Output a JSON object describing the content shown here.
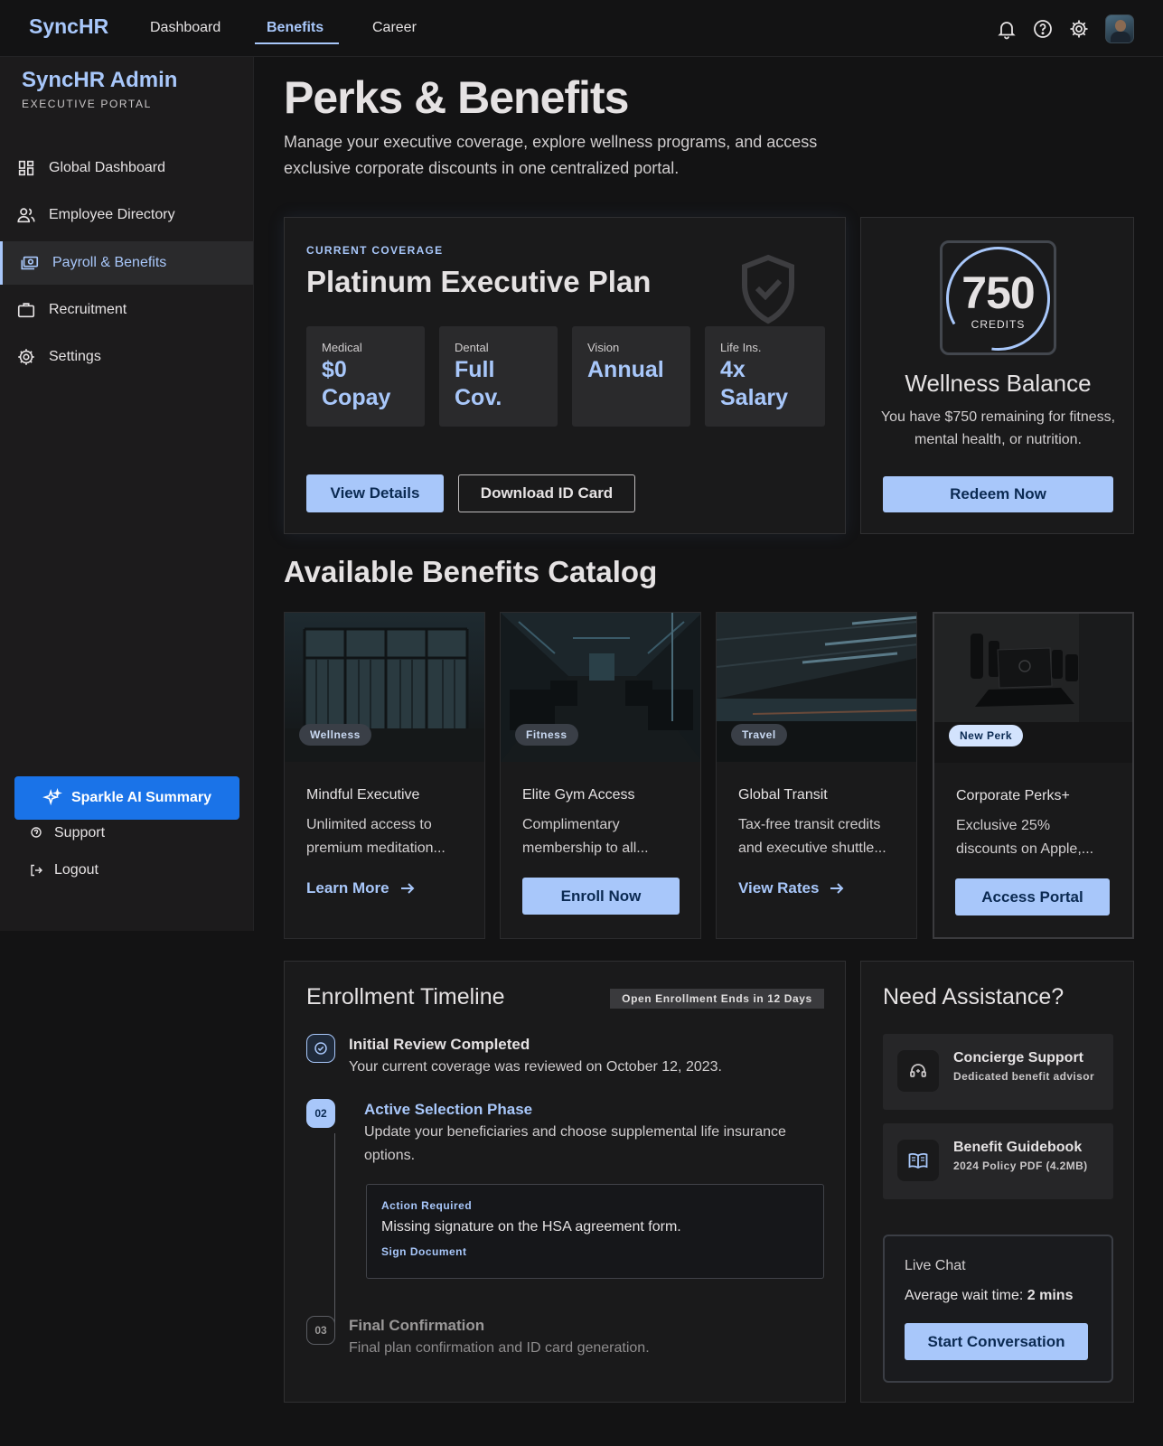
{
  "brand": "SyncHR",
  "top_nav": [
    "Dashboard",
    "Benefits",
    "Career"
  ],
  "top_icons": [
    "bell-icon",
    "help-icon",
    "gear-icon",
    "avatar"
  ],
  "sidebar": {
    "title": "SyncHR Admin",
    "subtitle": "EXECUTIVE PORTAL",
    "items": [
      {
        "label": "Global Dashboard",
        "icon": "dashboard-icon"
      },
      {
        "label": "Employee Directory",
        "icon": "people-icon"
      },
      {
        "label": "Payroll & Benefits",
        "icon": "payments-icon",
        "active": true
      },
      {
        "label": "Recruitment",
        "icon": "briefcase-icon"
      },
      {
        "label": "Settings",
        "icon": "gear-icon"
      }
    ],
    "ai_button": "Sparkle AI Summary",
    "support": "Support",
    "logout": "Logout"
  },
  "page": {
    "title": "Perks & Benefits",
    "description": "Manage your executive coverage, explore wellness programs, and access exclusive corporate discounts in one centralized portal."
  },
  "coverage": {
    "eyebrow": "CURRENT COVERAGE",
    "plan": "Platinum Executive Plan",
    "stats": [
      {
        "label": "Medical",
        "line1": "$0",
        "line2": "Copay"
      },
      {
        "label": "Dental",
        "line1": "Full",
        "line2": "Cov."
      },
      {
        "label": "Vision",
        "line1": "Annual",
        "line2": ""
      },
      {
        "label": "Life Ins.",
        "line1": "4x",
        "line2": "Salary"
      }
    ],
    "view_details": "View Details",
    "download": "Download ID Card"
  },
  "wellness": {
    "amount": "750",
    "unit": "CREDITS",
    "title": "Wellness Balance",
    "description": "You have $750 remaining for fitness, mental health, or nutrition.",
    "button": "Redeem Now"
  },
  "catalog": {
    "title": "Available Benefits Catalog",
    "cards": [
      {
        "tag": "Wellness",
        "title": "Mindful Executive",
        "desc1": "Unlimited access to",
        "desc2": "premium meditation...",
        "action": "Learn More"
      },
      {
        "tag": "Fitness",
        "title": "Elite Gym Access",
        "desc1": "Complimentary",
        "desc2": "membership to all...",
        "action": "Enroll Now"
      },
      {
        "tag": "Travel",
        "title": "Global Transit",
        "desc1": "Tax-free transit credits",
        "desc2": "and executive shuttle...",
        "action": "View Rates"
      },
      {
        "tag": "New Perk",
        "title": "Corporate Perks+",
        "desc1": "Exclusive 25%",
        "desc2": "discounts on Apple,...",
        "action": "Access Portal"
      }
    ]
  },
  "timeline": {
    "title": "Enrollment Timeline",
    "badge": "Open Enrollment Ends in 12 Days",
    "steps": [
      {
        "num": "",
        "title": "Initial Review Completed",
        "desc": "Your current coverage was reviewed on October 12, 2023."
      },
      {
        "num": "02",
        "title": "Active Selection Phase",
        "desc": "Update your beneficiaries and choose supplemental life insurance options."
      },
      {
        "num": "03",
        "title": "Final Confirmation",
        "desc": "Final plan confirmation and ID card generation."
      }
    ],
    "action": {
      "label": "Action Required",
      "message": "Missing signature on the HSA agreement form.",
      "link": "Sign Document"
    }
  },
  "assistance": {
    "title": "Need Assistance?",
    "items": [
      {
        "title": "Concierge Support",
        "subtitle": "Dedicated benefit advisor",
        "icon": "headset-icon"
      },
      {
        "title": "Benefit Guidebook",
        "subtitle": "2024 Policy PDF (4.2MB)",
        "icon": "book-icon"
      }
    ],
    "chat": {
      "title": "Live Chat",
      "wait_label": "Average wait time:",
      "wait_value": "2 mins",
      "button": "Start Conversation"
    }
  },
  "colors": {
    "accent": "#a8c7fa",
    "primary_button": "#1a73e8",
    "background": "#131314"
  }
}
